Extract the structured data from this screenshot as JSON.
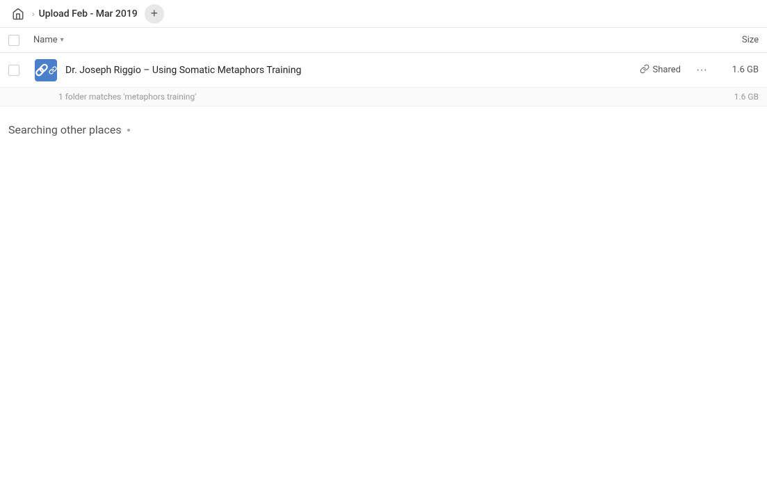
{
  "header": {
    "home_icon": "home",
    "chevron": "›",
    "breadcrumb_title": "Upload Feb - Mar 2019",
    "add_button_label": "+"
  },
  "table": {
    "columns": {
      "name_label": "Name",
      "sort_arrow": "▾",
      "size_label": "Size"
    }
  },
  "file_row": {
    "icon_type": "shared-folder",
    "name": "Dr. Joseph Riggio – Using Somatic Metaphors Training",
    "shared_label": "Shared",
    "more_icon": "•••",
    "size": "1.6 GB",
    "match_text": "1 folder matches 'metaphors training'",
    "match_size": "1.6 GB"
  },
  "searching_section": {
    "title": "Searching other places",
    "loading": true
  }
}
